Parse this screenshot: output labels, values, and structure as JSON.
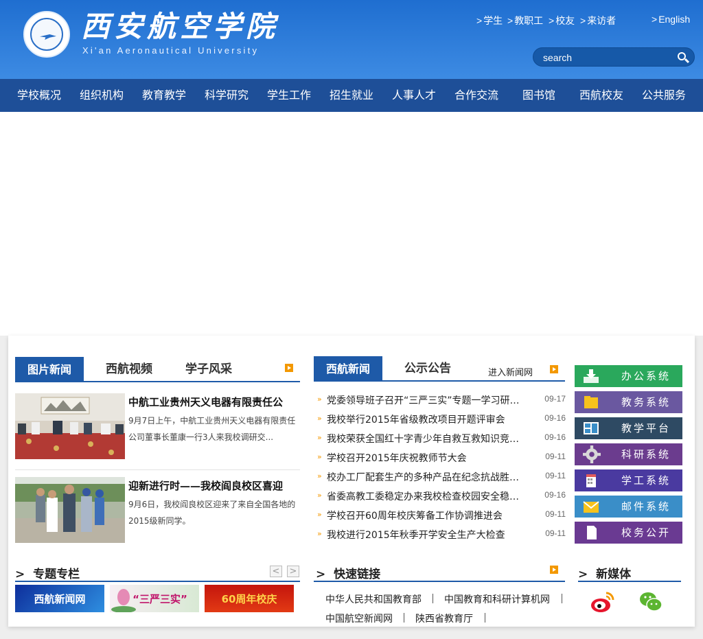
{
  "header": {
    "logo_cn": "西安航空学院",
    "logo_en": "Xi'an Aeronautical University",
    "top_links": [
      "学生",
      "教职工",
      "校友",
      "来访者",
      "English"
    ],
    "search_placeholder": "search"
  },
  "nav": [
    "学校概况",
    "组织机构",
    "教育教学",
    "科学研究",
    "学生工作",
    "招生就业",
    "人事人才",
    "合作交流",
    "图书馆",
    "西航校友",
    "公共服务"
  ],
  "photo_news": {
    "tabs": [
      "图片新闻",
      "西航视频",
      "学子风采"
    ],
    "items": [
      {
        "title": "中航工业贵州天义电器有限责任公",
        "desc": "9月7日上午，中航工业贵州天义电器有限责任公司董事长董康一行3人来我校调研交..."
      },
      {
        "title": "迎新进行时——我校阎良校区喜迎",
        "desc": "9月6日，我校阎良校区迎来了来自全国各地的2015级新同学。"
      }
    ]
  },
  "news": {
    "tabs": [
      "西航新闻",
      "公示公告"
    ],
    "more": "进入新闻网",
    "items": [
      {
        "title": "党委领导班子召开“三严三实”专题一学习研讨会",
        "date": "09-17"
      },
      {
        "title": "我校举行2015年省级教改项目开题评审会",
        "date": "09-16"
      },
      {
        "title": "我校荣获全国红十字青少年自救互救知识竞赛优秀组织奖",
        "date": "09-16"
      },
      {
        "title": "学校召开2015年庆祝教师节大会",
        "date": "09-11"
      },
      {
        "title": "校办工厂配套生产的多种产品在纪念抗战胜利阅兵中亮相",
        "date": "09-11"
      },
      {
        "title": "省委高教工委稳定办来我校检查校园安全稳定工作",
        "date": "09-16"
      },
      {
        "title": "学校召开60周年校庆筹备工作协调推进会",
        "date": "09-11"
      },
      {
        "title": "我校进行2015年秋季开学安全生产大检查",
        "date": "09-11"
      }
    ]
  },
  "systems": [
    {
      "label": "办公系统",
      "color": "#2aa85c",
      "icon": "download-icon"
    },
    {
      "label": "教务系统",
      "color": "#6a58a0",
      "icon": "folder-icon"
    },
    {
      "label": "教学平台",
      "color": "#2e4a63",
      "icon": "board-icon"
    },
    {
      "label": "科研系统",
      "color": "#6b3c8e",
      "icon": "gear-icon"
    },
    {
      "label": "学工系统",
      "color": "#4a3aa0",
      "icon": "calendar-icon"
    },
    {
      "label": "邮件系统",
      "color": "#3a8ec8",
      "icon": "mail-icon"
    },
    {
      "label": "校务公开",
      "color": "#6a3a92",
      "icon": "document-icon"
    }
  ],
  "special": {
    "title": "专题专栏",
    "prev": "<",
    "next": ">",
    "features": [
      "西航新闻网",
      "“三严三实”",
      "60周年校庆"
    ]
  },
  "quick_links": {
    "title": "快速链接",
    "links": [
      "中华人民共和国教育部",
      "中国教育和科研计算机网",
      "中国航空新闻网",
      "陕西省教育厅"
    ]
  },
  "new_media": {
    "title": "新媒体",
    "icons": [
      "weibo-icon",
      "wechat-icon"
    ]
  }
}
